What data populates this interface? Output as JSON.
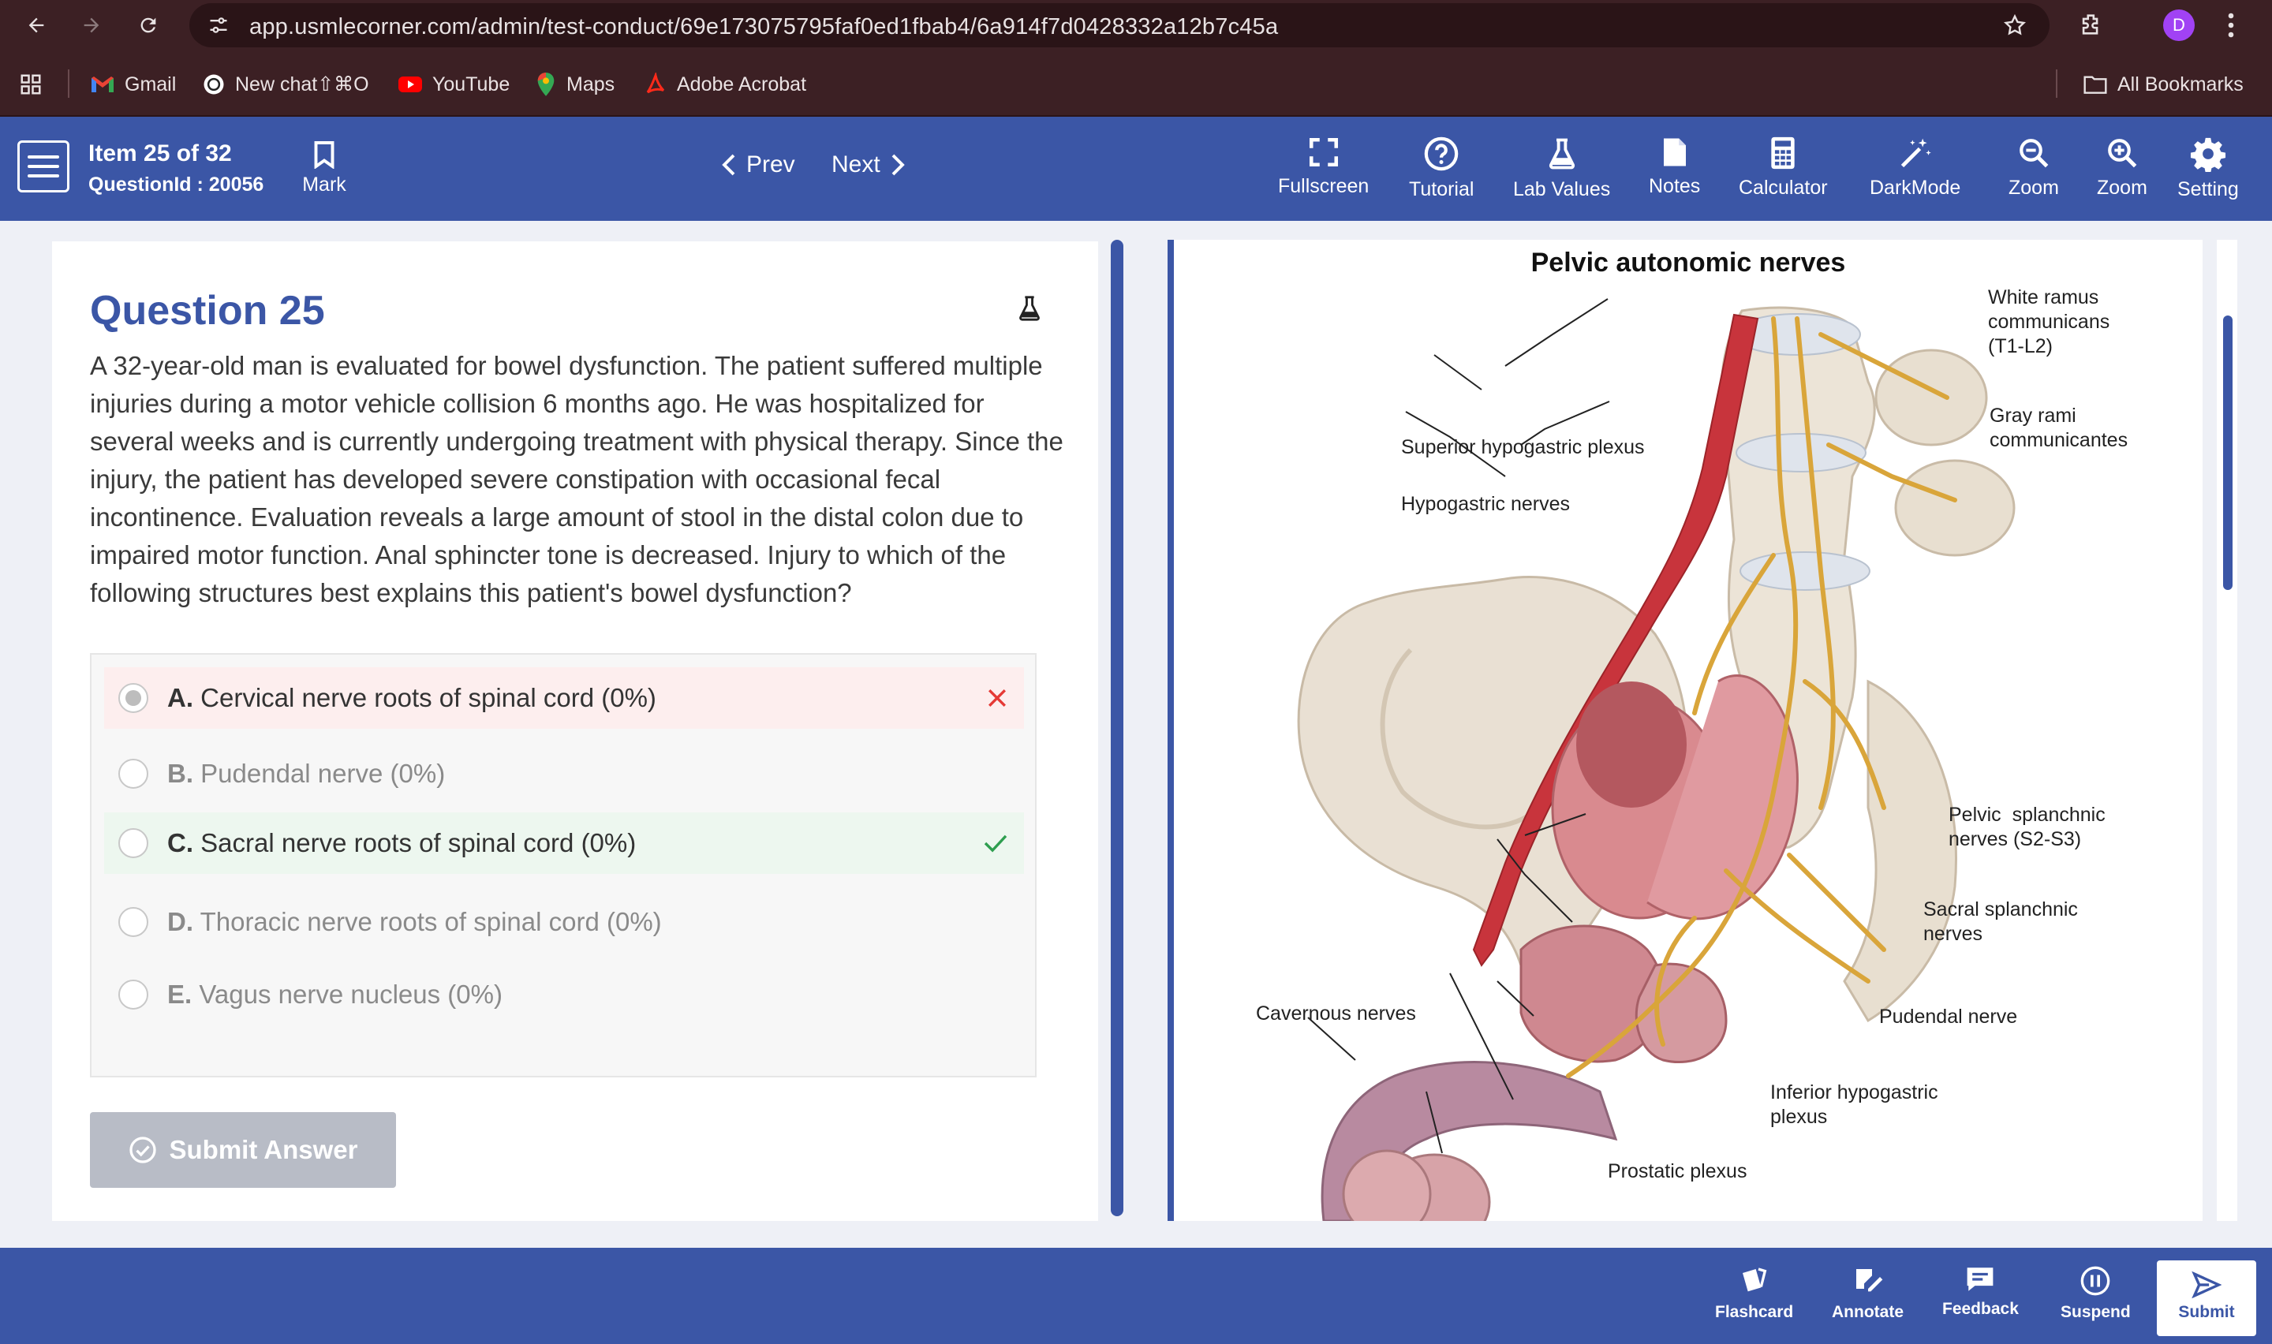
{
  "browser": {
    "url": "app.usmlecorner.com/admin/test-conduct/69e173075795faf0ed1fbab4/6a914f7d0428332a12b7c45a",
    "profile_initial": "D",
    "bookmarks": [
      {
        "label": "Gmail",
        "icon": "gmail-icon"
      },
      {
        "label": "New chat⇧⌘O",
        "icon": "chatgpt-icon"
      },
      {
        "label": "YouTube",
        "icon": "youtube-icon"
      },
      {
        "label": "Maps",
        "icon": "maps-icon"
      },
      {
        "label": "Adobe Acrobat",
        "icon": "acrobat-icon"
      }
    ],
    "all_bookmarks": "All Bookmarks"
  },
  "header": {
    "item": "Item 25 of 32",
    "question_id": "QuestionId : 20056",
    "mark": "Mark",
    "prev": "Prev",
    "next": "Next",
    "tools": [
      {
        "label": "Fullscreen",
        "icon": "fullscreen-icon"
      },
      {
        "label": "Tutorial",
        "icon": "help-icon"
      },
      {
        "label": "Lab Values",
        "icon": "flask-icon"
      },
      {
        "label": "Notes",
        "icon": "notes-icon"
      },
      {
        "label": "Calculator",
        "icon": "calculator-icon"
      },
      {
        "label": "DarkMode",
        "icon": "darkmode-icon"
      },
      {
        "label": "Zoom",
        "icon": "zoom-out-icon"
      },
      {
        "label": "Zoom",
        "icon": "zoom-in-icon"
      },
      {
        "label": "Setting",
        "icon": "gear-icon"
      }
    ]
  },
  "question": {
    "title": "Question 25",
    "text": "A 32-year-old man is evaluated for bowel dysfunction.  The patient suffered multiple injuries during a motor vehicle collision 6 months ago.  He was hospitalized for several weeks and is currently undergoing treatment with physical therapy.  Since the injury, the patient has developed severe constipation with occasional fecal incontinence.  Evaluation reveals a large amount of stool in the distal colon due to impaired motor function.  Anal sphincter tone is decreased.  Injury to which of the following structures best explains this patient's bowel dysfunction?",
    "choices": [
      {
        "letter": "A.",
        "text": "Cervical nerve roots of spinal cord (0%)",
        "state": "selected-incorrect"
      },
      {
        "letter": "B.",
        "text": "Pudendal nerve (0%)",
        "state": "none"
      },
      {
        "letter": "C.",
        "text": "Sacral nerve roots of spinal cord (0%)",
        "state": "correct"
      },
      {
        "letter": "D.",
        "text": "Thoracic nerve roots of spinal cord (0%)",
        "state": "none"
      },
      {
        "letter": "E.",
        "text": "Vagus nerve nucleus (0%)",
        "state": "none"
      }
    ],
    "submit": "Submit Answer"
  },
  "figure": {
    "title": "Pelvic autonomic nerves",
    "labels": {
      "white_ramus": "White ramus\ncommunicans\n(T1-L2)",
      "gray_rami": "Gray rami\ncommunicantes",
      "superior_hypogastric": "Superior hypogastric plexus",
      "hypogastric_nerves": "Hypogastric nerves",
      "pelvic_splanchnic": "Pelvic  splanchnic\nnerves (S2-S3)",
      "sacral_splanchnic": "Sacral splanchnic\nnerves",
      "cavernous": "Cavernous nerves",
      "pudendal": "Pudendal nerve",
      "inferior_hypogastric": "Inferior hypogastric\nplexus",
      "prostatic": "Prostatic plexus"
    }
  },
  "footer": {
    "buttons": [
      {
        "label": "Flashcard",
        "icon": "flashcard-icon"
      },
      {
        "label": "Annotate",
        "icon": "annotate-icon"
      },
      {
        "label": "Feedback",
        "icon": "feedback-icon"
      },
      {
        "label": "Suspend",
        "icon": "pause-icon"
      }
    ],
    "submit": "Submit"
  },
  "colors": {
    "brand": "#3b56a6",
    "browser_bg": "#3c2024",
    "incorrect_bg": "#fdeeee",
    "correct_bg": "#edf7ef",
    "incorrect": "#e53935",
    "correct": "#2e9e4f"
  }
}
